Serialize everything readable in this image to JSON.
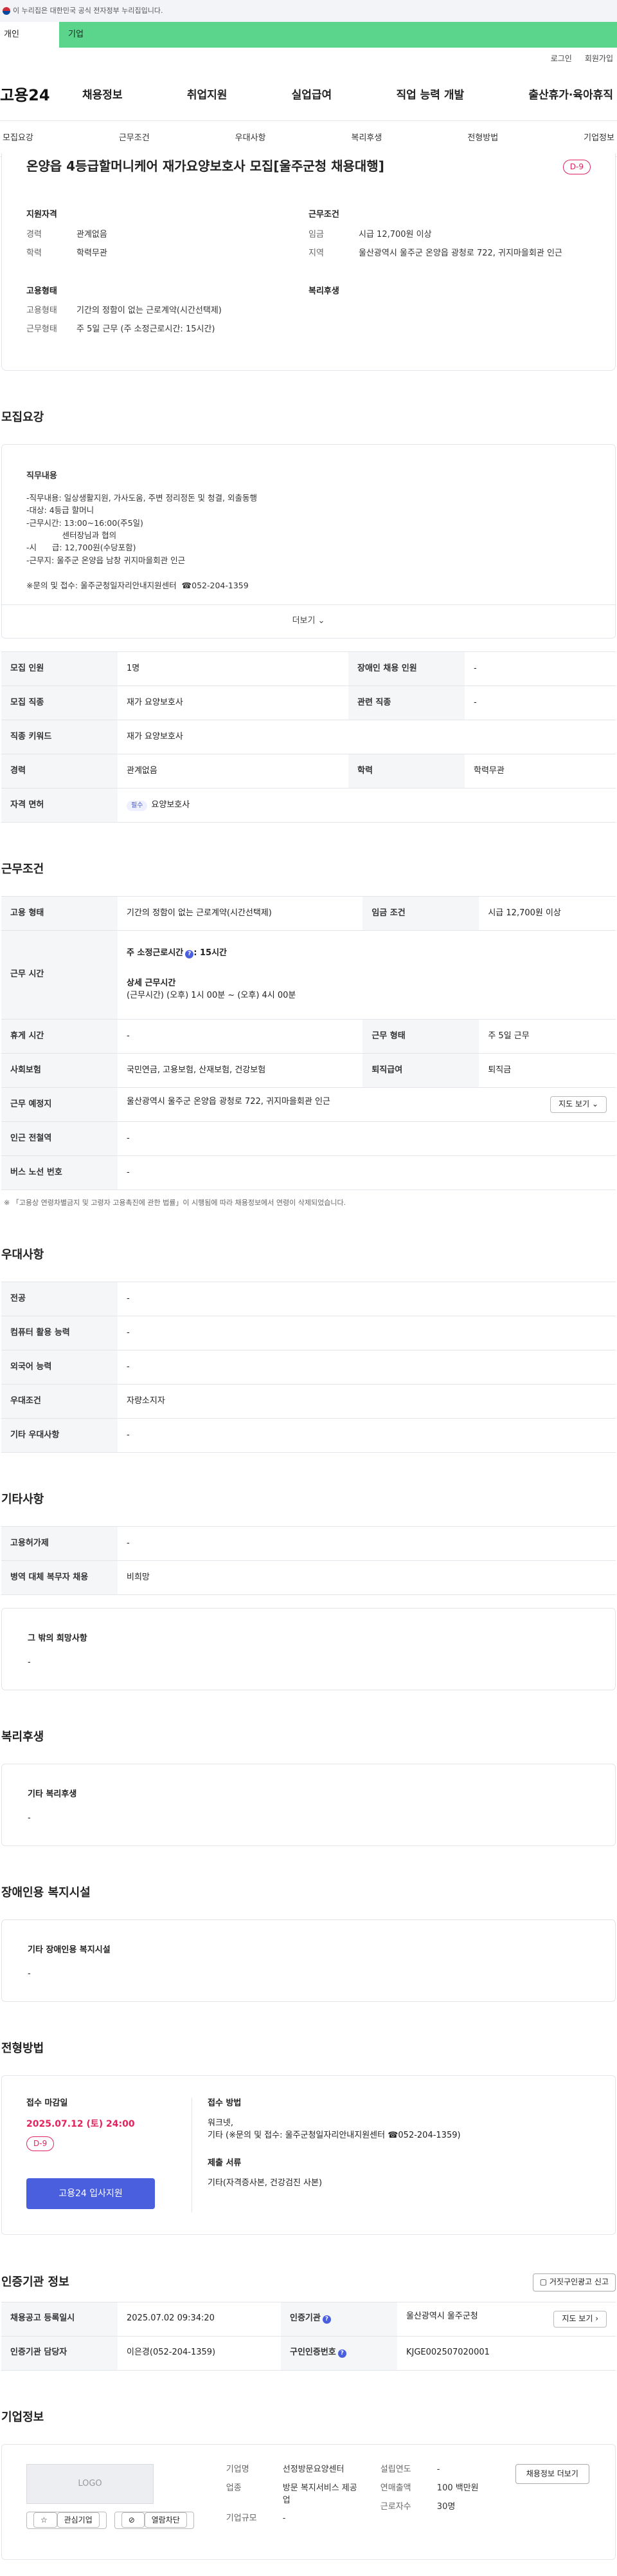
{
  "gov_banner": "이 누리집은 대한민국 공식 전자정부 누리집입니다.",
  "user_tabs": {
    "person": "개인",
    "business": "기업"
  },
  "util": {
    "login": "로그인",
    "signup": "회원가입"
  },
  "logo": "고용24",
  "gnb": [
    "채용정보",
    "취업지원",
    "실업급여",
    "직업 능력 개발",
    "출산휴가·육아휴직"
  ],
  "subnav": [
    "모집요강",
    "근무조건",
    "우대사항",
    "복리후생",
    "전형방법",
    "기업정보"
  ],
  "title": "온양읍 4등급할머니케어 재가요양보호사 모집[울주군청 채용대행]",
  "dday": "D-9",
  "summary": {
    "qual_title": "지원자격",
    "career_label": "경력",
    "career": "관계없음",
    "edu_label": "학력",
    "edu": "학력무관",
    "cond_title": "근무조건",
    "wage_label": "임금",
    "wage": "시급 12,700원 이상",
    "area_label": "지역",
    "area": "울산광역시 울주군 온양읍 광청로 722, 귀지마을회관 인근",
    "emp_title": "고용형태",
    "emp_label": "고용형태",
    "emp": "기간의 정함이 없는 근로계약(시간선택제)",
    "work_label": "근무형태",
    "work": "주 5일 근무 (주 소정근로시간: 15시간)",
    "welfare_title": "복리후생"
  },
  "sec_recruit": "모집요강",
  "duty_title": "직무내용",
  "duty_text": "-직무내용: 일상생활지원, 가사도움, 주변 정리정돈 및 청결, 외출동행\n-대상: 4등급 할머니\n-근무시간: 13:00~16:00(주5일)\n              센터장님과 협의\n-시      급: 12,700원(수당포함)\n-근무지: 울주군 온양읍 남창 귀지마을회관 인근\n\n※문의 및 접수: 울주군청일자리안내지원센터  ☎052-204-1359",
  "more": "더보기",
  "recruit_rows": {
    "count_label": "모집 인원",
    "count": "1명",
    "disabled_label": "장애인 채용 인원",
    "disabled": "-",
    "job_label": "모집 직종",
    "job": "재가 요양보호사",
    "related_label": "관련 직종",
    "related": "-",
    "keyword_label": "직종 키워드",
    "keyword": "재가 요양보호사",
    "career_label": "경력",
    "career": "관계없음",
    "edu_label": "학력",
    "edu": "학력무관",
    "license_label": "자격 면허",
    "license_badge": "필수",
    "license": "요양보호사"
  },
  "sec_cond": "근무조건",
  "cond_rows": {
    "emp_label": "고용 형태",
    "emp": "기간의 정함이 없는 근로계약(시간선택제)",
    "wage_label": "임금 조건",
    "wage": "시급 12,700원 이상",
    "time_label": "근무 시간",
    "weekly": "주 소정근로시간",
    "weekly_val": ": 15시간",
    "detail_title": "상세 근무시간",
    "detail": "(근무시간) (오후) 1시 00분 ~ (오후) 4시 00분",
    "rest_label": "휴게 시간",
    "rest": "-",
    "worktype_label": "근무 형태",
    "worktype": "주 5일 근무",
    "insurance_label": "사회보험",
    "insurance": "국민연금, 고용보험, 산재보험, 건강보험",
    "retire_label": "퇴직급여",
    "retire": "퇴직금",
    "place_label": "근무 예정지",
    "place": "울산광역시 울주군 온양읍 광청로 722, 귀지마을회관 인근",
    "map_btn": "지도 보기",
    "station_label": "인근 전철역",
    "station": "-",
    "bus_label": "버스 노선 번호",
    "bus": "-"
  },
  "cond_note": "「고용상 연령차별금지 및 고령자 고용촉진에 관한 법률」이 시행됨에 따라 채용정보에서 연령이 삭제되었습니다.",
  "sec_pref": "우대사항",
  "pref_rows": [
    {
      "label": "전공",
      "value": "-"
    },
    {
      "label": "컴퓨터 활용 능력",
      "value": "-"
    },
    {
      "label": "외국어 능력",
      "value": "-"
    },
    {
      "label": "우대조건",
      "value": "자량소지자"
    },
    {
      "label": "기타 우대사항",
      "value": "-"
    }
  ],
  "sec_etc": "기타사항",
  "etc_rows": [
    {
      "label": "고용허가제",
      "value": "-"
    },
    {
      "label": "병역 대체 복무자 채용",
      "value": "비희망"
    }
  ],
  "etc_box": {
    "title": "그 밖의 희망사항",
    "value": "-"
  },
  "sec_welfare": "복리후생",
  "welfare_box": {
    "title": "기타 복리후생",
    "value": "-"
  },
  "sec_disabled": "장애인용 복지시설",
  "disabled_box": {
    "title": "기타 장애인용 복지시설",
    "value": "-"
  },
  "sec_apply": "전형방법",
  "apply": {
    "deadline_title": "접수 마감일",
    "deadline": "2025.07.12 (토) 24:00",
    "dday": "D-9",
    "apply_btn": "고용24 입사지원",
    "method_title": "접수 방법",
    "method": "워크넷,",
    "method2": "기타 (※문의 및 접수: 울주군청일자리안내지원센터  ☎052-204-1359)",
    "docs_title": "제출 서류",
    "docs": "기타(자격증사본, 건강검진 사본)"
  },
  "sec_org": "인증기관 정보",
  "org_btn": "거짓구인광고 신고",
  "org_rows": {
    "reg_label": "채용공고 등록일시",
    "reg": "2025.07.02 09:34:20",
    "org_label": "인증기관",
    "org": "울산광역시 울주군청",
    "map_btn": "지도 보기",
    "manager_label": "인증기관 담당자",
    "manager": "이은경(052-204-1359)",
    "id_label": "구인인증번호",
    "id": "KJGE002507020001"
  },
  "sec_company": "기업정보",
  "company": {
    "logo": "LOGO",
    "fav_btn": "관심기업",
    "block_btn": "열람차단",
    "name_label": "기업명",
    "name": "선정방문요양센터",
    "industry_label": "업종",
    "industry": "방문 복지서비스 제공업",
    "size_label": "기업규모",
    "size": "-",
    "year_label": "설립연도",
    "year": "-",
    "revenue_label": "연매출액",
    "revenue": "100 백만원",
    "staff_label": "근로자수",
    "staff": "30명",
    "more_btn": "채용정보 더보기"
  }
}
